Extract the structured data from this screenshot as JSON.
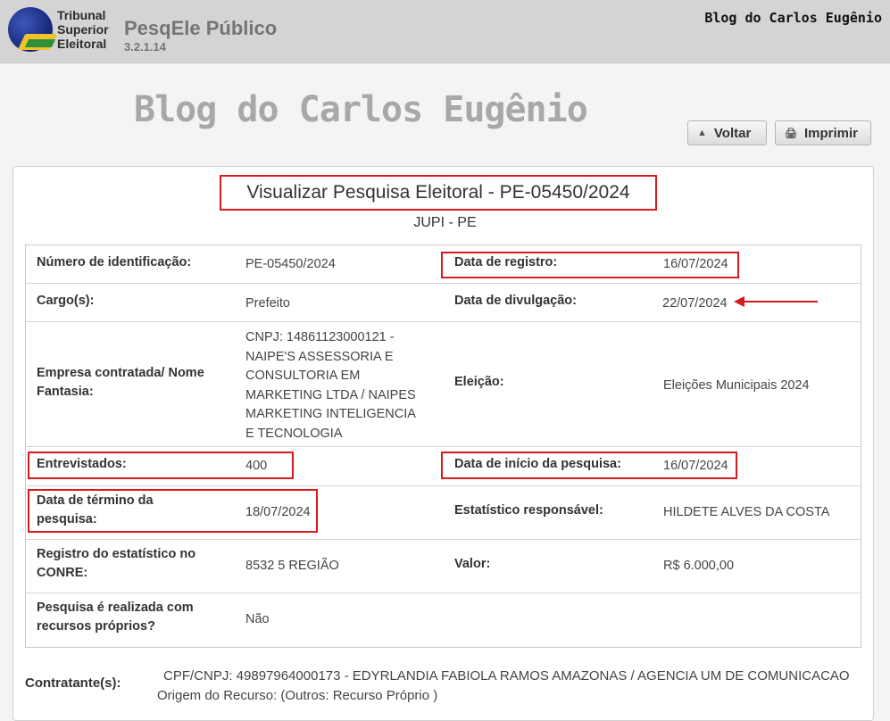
{
  "header": {
    "org_line1": "Tribunal",
    "org_line2": "Superior",
    "org_line3": "Eleitoral",
    "app_title": "PesqEle Público",
    "app_version": "3.2.1.14",
    "watermark_small": "Blog do Carlos Eugênio"
  },
  "watermark_big": "Blog do Carlos Eugênio",
  "toolbar": {
    "back_label": "Voltar",
    "print_label": "Imprimir"
  },
  "page": {
    "title": "Visualizar Pesquisa Eleitoral - PE-05450/2024",
    "subtitle": "JUPI - PE"
  },
  "details": {
    "numero_label": "Número de identificação:",
    "numero_value": "PE-05450/2024",
    "data_registro_label": "Data de registro:",
    "data_registro_value": "16/07/2024",
    "cargo_label": "Cargo(s):",
    "cargo_value": "Prefeito",
    "data_divulgacao_label": "Data de divulgação:",
    "data_divulgacao_value": "22/07/2024",
    "empresa_label_1": "Empresa contratada/ Nome",
    "empresa_label_2": "Fantasia:",
    "empresa_value_lines": [
      "CNPJ: 14861123000121 -",
      "NAIPE'S ASSESSORIA E",
      "CONSULTORIA EM",
      "MARKETING LTDA / NAIPES",
      "MARKETING INTELIGENCIA",
      "E TECNOLOGIA"
    ],
    "eleicao_label": "Eleição:",
    "eleicao_value": "Eleições Municipais 2024",
    "entrevistados_label": "Entrevistados:",
    "entrevistados_value": "400",
    "data_inicio_label": "Data de início da pesquisa:",
    "data_inicio_value": "16/07/2024",
    "data_termino_label_1": "Data de término da",
    "data_termino_label_2": "pesquisa:",
    "data_termino_value": "18/07/2024",
    "estatistico_label": "Estatístico responsável:",
    "estatistico_value": "HILDETE ALVES DA COSTA",
    "registro_label_1": "Registro do estatístico no",
    "registro_label_2": "CONRE:",
    "registro_value": "8532 5 REGIÃO",
    "valor_label": "Valor:",
    "valor_value": "R$ 6.000,00",
    "recursos_label_1": "Pesquisa é realizada com",
    "recursos_label_2": "recursos próprios?",
    "recursos_value": "Não"
  },
  "contratante": {
    "label": "Contratante(s):",
    "value": "CPF/CNPJ: 49897964000173 - EDYRLANDIA FABIOLA RAMOS AMAZONAS / AGENCIA UM DE COMUNICACAO",
    "origin": "Origem do Recurso: (Outros: Recurso Próprio )"
  },
  "colors": {
    "highlight": "#d71920",
    "header_bg": "#d4d4d4",
    "watermark": "#a8a8a8"
  }
}
